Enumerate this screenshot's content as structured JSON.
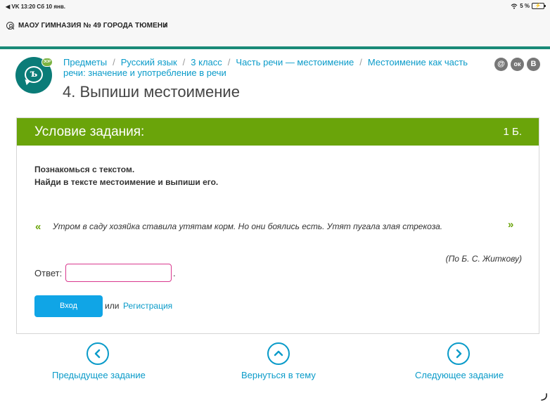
{
  "status_bar": {
    "left": "◀ VK  13:20  Сб 10 янв.",
    "battery": "5 %",
    "wifi_icon": "wifi-icon"
  },
  "school_bar": {
    "name": "МАОУ ГИМНАЗИЯ № 49 ГОРОДА ТЮМЕНИ",
    "chevron": "›"
  },
  "logo": {
    "glyph": "ъ",
    "badge": "ЭОР"
  },
  "breadcrumb": {
    "items": [
      "Предметы",
      "Русский язык",
      "3 класс",
      "Часть речи — местоимение",
      "Местоимение как часть речи: значение и употребление в речи"
    ],
    "separator": "/"
  },
  "page_title": "4. Выпиши местоимение",
  "social": {
    "mail": "@",
    "ok": "ок",
    "vk": "В"
  },
  "task": {
    "header_label": "Условие задания:",
    "points": "1 Б.",
    "instruction_1": "Познакомься с текстом.",
    "instruction_2": "Найди в тексте местоимение и выпиши его.",
    "quote_open": "«",
    "quote_text": "Утром в саду хозяйка ставила утятам корм. Но они боялись есть. Утят пугала злая стрекоза.",
    "quote_close": "»",
    "author": "(По Б. С. Житкову)",
    "answer_label": "Ответ:",
    "answer_value": "",
    "answer_suffix": ".",
    "login_button": "Вход",
    "or_text": "или",
    "register_link": "Регистрация"
  },
  "bottom_nav": {
    "prev": "Предыдущее задание",
    "back": "Вернуться в тему",
    "next": "Следующее задание"
  },
  "colors": {
    "accent": "#0a9bc9",
    "header_green": "#6aa40a",
    "teal": "#0b7c78",
    "input_border": "#d9388e",
    "button_blue": "#10a5e6"
  }
}
